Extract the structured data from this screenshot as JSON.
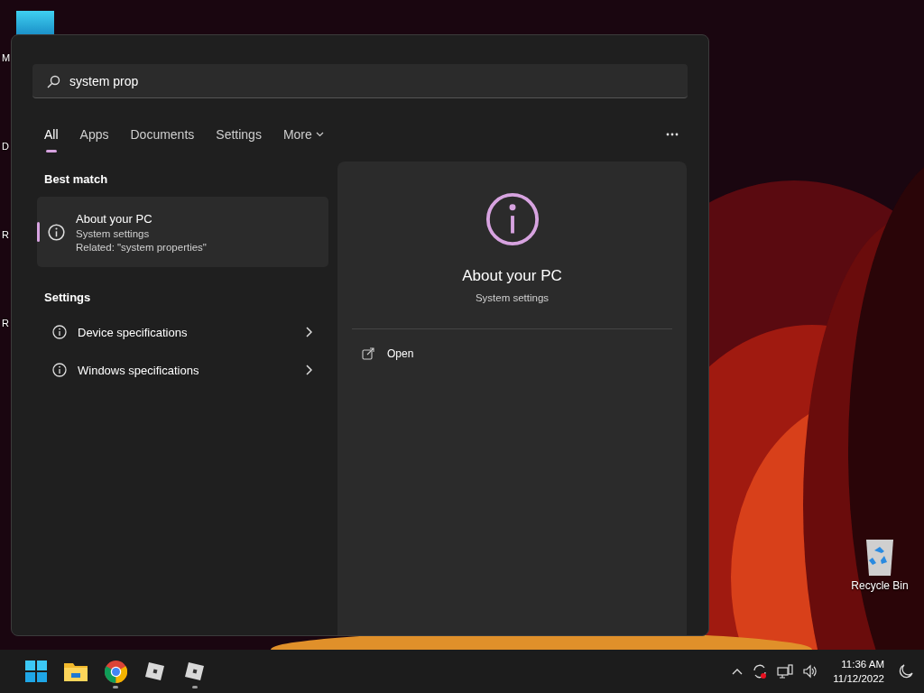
{
  "search": {
    "value": "system prop"
  },
  "tabs": [
    {
      "label": "All",
      "selected": true,
      "kind": "tab"
    },
    {
      "label": "Apps",
      "selected": false,
      "kind": "tab"
    },
    {
      "label": "Documents",
      "selected": false,
      "kind": "tab"
    },
    {
      "label": "Settings",
      "selected": false,
      "kind": "tab"
    },
    {
      "label": "More",
      "selected": false,
      "kind": "dropdown"
    }
  ],
  "best_match": {
    "heading": "Best match",
    "item": {
      "title": "About your PC",
      "subtitle": "System settings",
      "related": "Related: \"system properties\"",
      "selected": true
    }
  },
  "settings": {
    "heading": "Settings",
    "items": [
      {
        "label": "Device specifications"
      },
      {
        "label": "Windows specifications"
      }
    ]
  },
  "preview": {
    "title": "About your PC",
    "subtitle": "System settings",
    "actions": [
      {
        "label": "Open"
      }
    ]
  },
  "desktop_icons": [
    {
      "label": "M"
    },
    {
      "label": "D"
    },
    {
      "label": "R"
    },
    {
      "label": "R"
    },
    {
      "label": "Recycle Bin"
    }
  ],
  "taskbar": {
    "apps": [
      {
        "kind": "start",
        "running": false
      },
      {
        "kind": "folder",
        "running": false
      },
      {
        "kind": "browser",
        "running": true
      },
      {
        "kind": "cube",
        "running": false
      },
      {
        "kind": "cube",
        "running": true
      }
    ],
    "time": "11:36 AM",
    "date": "11/12/2022"
  }
}
